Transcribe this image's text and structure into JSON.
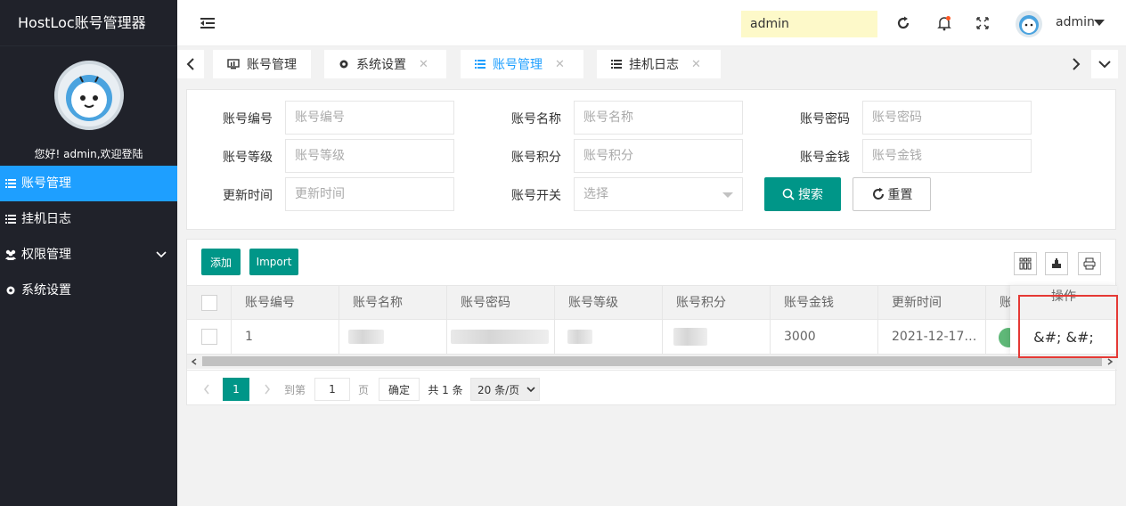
{
  "app": {
    "title": "HostLoc账号管理器"
  },
  "sidebar": {
    "welcome": "您好! admin,欢迎登陆",
    "items": [
      {
        "label": "账号管理",
        "icon": "list-icon",
        "active": true
      },
      {
        "label": "挂机日志",
        "icon": "list-icon",
        "active": false
      },
      {
        "label": "权限管理",
        "icon": "users-icon",
        "active": false,
        "expandable": true
      },
      {
        "label": "系统设置",
        "icon": "gear-icon",
        "active": false
      }
    ]
  },
  "header": {
    "search_value": "admin",
    "username": "admin"
  },
  "tabs": [
    {
      "label": "账号管理",
      "icon": "monitor-icon",
      "closable": false,
      "active": false
    },
    {
      "label": "系统设置",
      "icon": "gear-icon",
      "closable": true,
      "active": false
    },
    {
      "label": "账号管理",
      "icon": "list-icon",
      "closable": true,
      "active": true
    },
    {
      "label": "挂机日志",
      "icon": "list-icon",
      "closable": true,
      "active": false
    }
  ],
  "form": {
    "fields": [
      {
        "label": "账号编号",
        "placeholder": "账号编号"
      },
      {
        "label": "账号名称",
        "placeholder": "账号名称"
      },
      {
        "label": "账号密码",
        "placeholder": "账号密码"
      },
      {
        "label": "账号等级",
        "placeholder": "账号等级"
      },
      {
        "label": "账号积分",
        "placeholder": "账号积分"
      },
      {
        "label": "账号金钱",
        "placeholder": "账号金钱"
      },
      {
        "label": "更新时间",
        "placeholder": "更新时间"
      },
      {
        "label": "账号开关",
        "placeholder": "选择"
      }
    ],
    "search_label": "搜索",
    "reset_label": "重置"
  },
  "toolbar": {
    "add_label": "添加",
    "import_label": "Import"
  },
  "table": {
    "columns": [
      "账号编号",
      "账号名称",
      "账号密码",
      "账号等级",
      "账号积分",
      "账号金钱",
      "更新时间",
      "账",
      "操作"
    ],
    "rows": [
      {
        "id": "1",
        "name": "",
        "password": "",
        "level": "",
        "points": "",
        "money": "3000",
        "updated": "2021-12-17…",
        "actions": "&#; &#;"
      }
    ]
  },
  "pager": {
    "current": "1",
    "goto_label": "到第",
    "goto_value": "1",
    "page_unit": "页",
    "confirm_label": "确定",
    "total": "共 1 条",
    "page_size": "20 条/页"
  }
}
